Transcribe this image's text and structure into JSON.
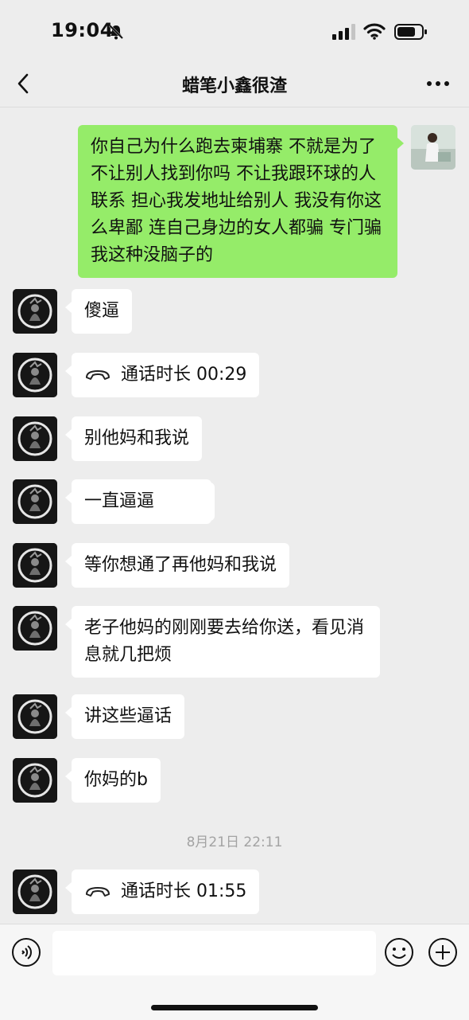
{
  "status_bar": {
    "time": "19:04",
    "icons": [
      "bell-slash-icon",
      "cellular-signal-icon",
      "wifi-icon",
      "battery-icon"
    ]
  },
  "header": {
    "title": "蜡笔小鑫很渣",
    "back_icon": "chevron-left-icon",
    "more_icon": "more-dots-icon"
  },
  "messages": [
    {
      "side": "right",
      "type": "text",
      "text": "你自己为什么跑去柬埔寨 不就是为了不让别人找到你吗 不让我跟环球的人联系 担心我发地址给别人 我没有你这么卑鄙 连自己身边的女人都骗 专门骗我这种没脑子的"
    },
    {
      "side": "left",
      "type": "text",
      "text": "傻逼"
    },
    {
      "side": "left",
      "type": "call",
      "text": "通话时长 00:29"
    },
    {
      "side": "left",
      "type": "text",
      "text": "别他妈和我说"
    },
    {
      "side": "left",
      "type": "text",
      "text": "一直逼逼"
    },
    {
      "side": "left",
      "type": "text",
      "text": "等你想通了再他妈和我说"
    },
    {
      "side": "left",
      "type": "text",
      "text": "老子他妈的刚刚要去给你送，看见消息就几把烦"
    },
    {
      "side": "left",
      "type": "text",
      "text": "讲这些逼话"
    },
    {
      "side": "left",
      "type": "text",
      "text": "你妈的b"
    },
    {
      "side": "center",
      "type": "timestamp",
      "text": "8月21日 22:11"
    },
    {
      "side": "left",
      "type": "call",
      "text": "通话时长 01:55"
    }
  ],
  "input_bar": {
    "placeholder": "",
    "icons": [
      "voice-icon",
      "emoji-icon",
      "plus-icon"
    ]
  },
  "colors": {
    "background": "#ededed",
    "outgoing_bubble": "#95ec69",
    "incoming_bubble": "#ffffff",
    "timestamp": "#a3a3a3"
  }
}
